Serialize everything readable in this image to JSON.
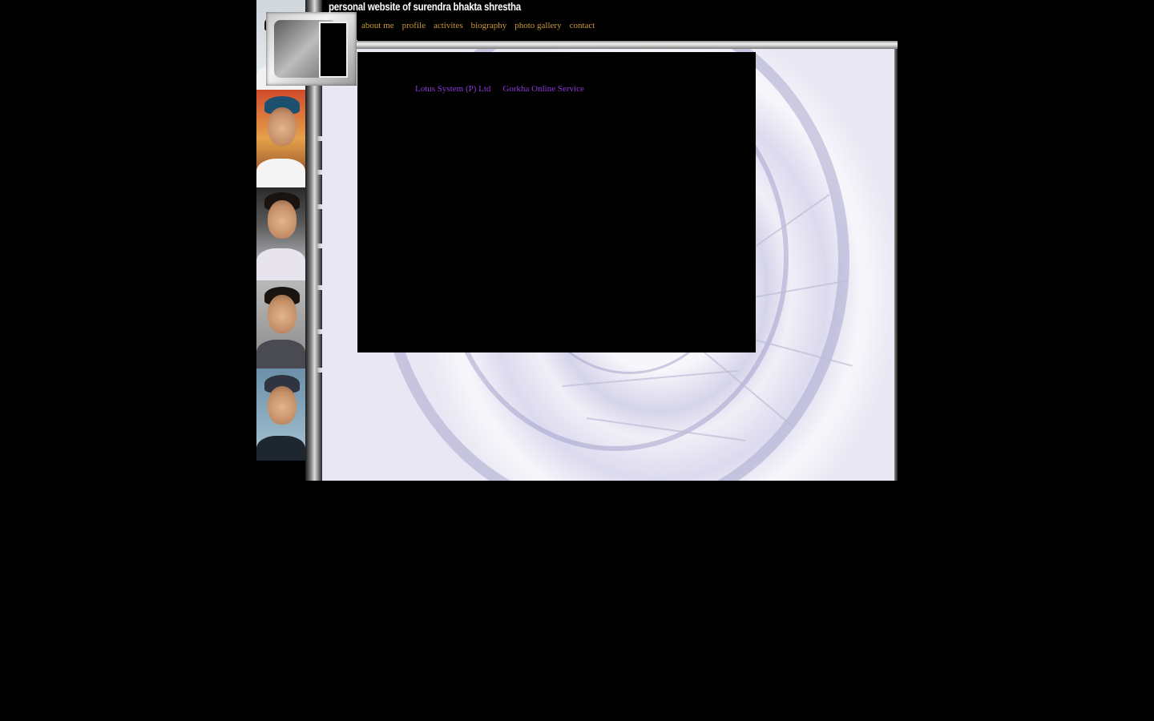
{
  "site": {
    "title": "personal website of surendra bhakta shrestha"
  },
  "nav": {
    "items": [
      {
        "label": "about me"
      },
      {
        "label": "profile"
      },
      {
        "label": "activites"
      },
      {
        "label": "biography"
      },
      {
        "label": "photo gallery"
      },
      {
        "label": "contact"
      }
    ]
  },
  "content": {
    "links": [
      {
        "label": "Lotus System (P) Ltd"
      },
      {
        "label": "Gorkha Online Service"
      }
    ]
  },
  "colors": {
    "page_background": "#000000",
    "nav_link": "#c89a35",
    "content_link": "#8c38d8"
  },
  "icons": {
    "photo_strip": "portrait-photos",
    "frame": "decorative-film-frame"
  }
}
